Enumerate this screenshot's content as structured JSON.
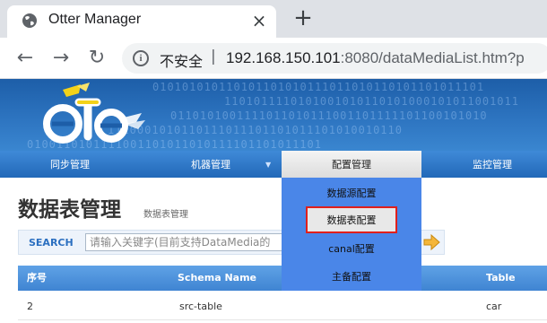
{
  "browser": {
    "tab_title": "Otter Manager",
    "close_icon": "×",
    "new_tab_icon": "+",
    "back_icon": "←",
    "forward_icon": "→",
    "reload_icon": "↻",
    "info_icon": "i",
    "security_label": "不安全",
    "url_separator": "|",
    "url_host": "192.168.150.101",
    "url_rest": ":8080/dataMediaList.htm?p"
  },
  "banner": {
    "binary_rows": [
      "010101010110101101010111011010110101101011101",
      "1101011110101001010110101000101011001011",
      "0110101001111011010111001101111101100101010",
      "1110001010110111011101101011101010010110",
      "0100110101111001101011010111101101011101"
    ]
  },
  "nav": {
    "items": [
      "同步管理",
      "机器管理",
      "配置管理",
      "监控管理"
    ],
    "caret": "▼"
  },
  "dropdown": {
    "items": [
      "数据源配置",
      "数据表配置",
      "canal配置",
      "主备配置"
    ]
  },
  "page": {
    "title": "数据表管理",
    "subtitle": "数据表管理"
  },
  "search": {
    "label": "SEARCH",
    "placeholder": "请输入关键字(目前支持DataMedia的"
  },
  "table": {
    "columns": [
      "序号",
      "Schema Name",
      "Table Name"
    ],
    "rows": [
      [
        "2",
        "src-table",
        "car"
      ]
    ]
  },
  "colors": {
    "accent": "#2b6fc0",
    "banner": "#2d74c0",
    "dropdown": "#4a86e8",
    "highlight_border": "#e0201c"
  }
}
